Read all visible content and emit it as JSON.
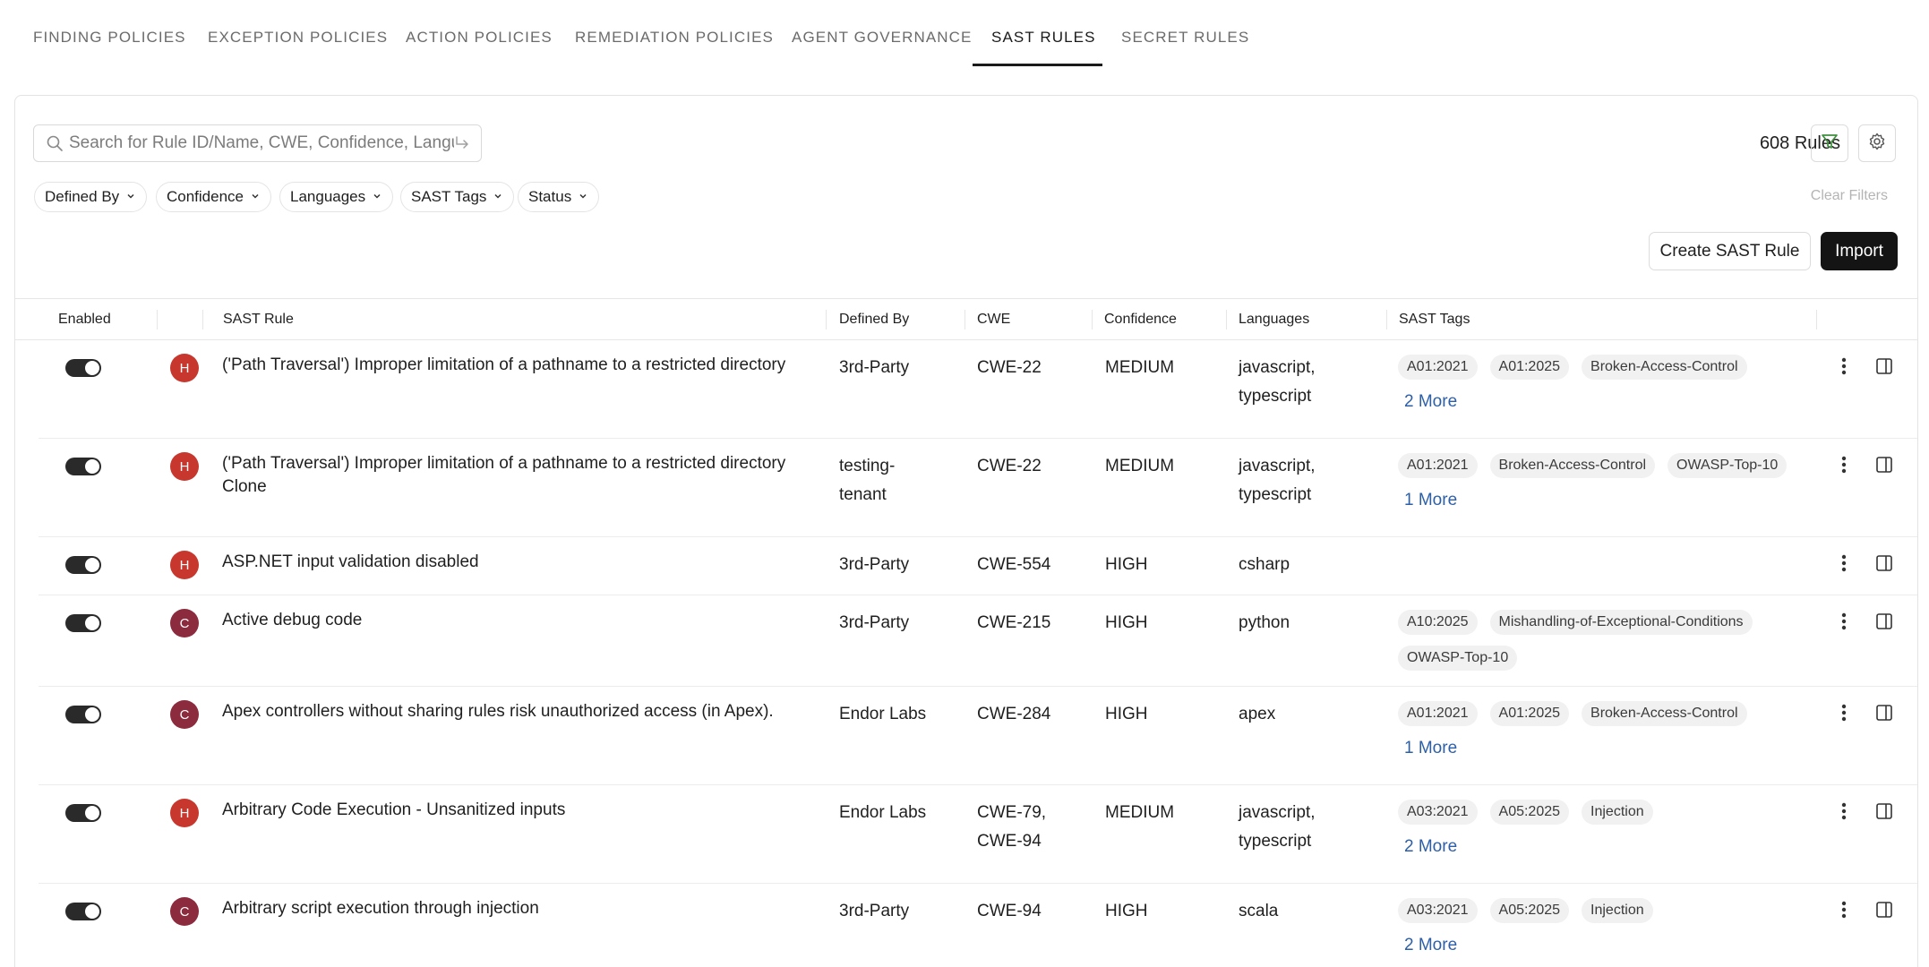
{
  "tabs": [
    {
      "label": "FINDING POLICIES"
    },
    {
      "label": "EXCEPTION POLICIES"
    },
    {
      "label": "ACTION POLICIES"
    },
    {
      "label": "REMEDIATION POLICIES"
    },
    {
      "label": "AGENT GOVERNANCE"
    },
    {
      "label": "SAST RULES",
      "active": true
    },
    {
      "label": "SECRET RULES"
    }
  ],
  "search": {
    "placeholder": "Search for Rule ID/Name, CWE, Confidence, Language",
    "value": ""
  },
  "rules_count": "608 Rules",
  "filters": [
    "Defined By",
    "Confidence",
    "Languages",
    "SAST Tags",
    "Status"
  ],
  "clear_filters": "Clear Filters",
  "actions": {
    "create": "Create SAST Rule",
    "import": "Import"
  },
  "columns": {
    "enabled": "Enabled",
    "rule": "SAST Rule",
    "defined_by": "Defined By",
    "cwe": "CWE",
    "confidence": "Confidence",
    "languages": "Languages",
    "tags": "SAST Tags"
  },
  "rows": [
    {
      "enabled": true,
      "severity": "H",
      "name": "('Path Traversal') Improper limitation of a pathname to a restricted directory",
      "defined_by": "3rd-Party",
      "cwe": "CWE-22",
      "confidence": "MEDIUM",
      "languages": "javascript,\ntypescript",
      "tags": [
        "A01:2021",
        "A01:2025",
        "Broken-Access-Control"
      ],
      "more": "2 More"
    },
    {
      "enabled": true,
      "severity": "H",
      "name": "('Path Traversal') Improper limitation of a pathname to a restricted directory Clone",
      "defined_by": "testing-\ntenant",
      "cwe": "CWE-22",
      "confidence": "MEDIUM",
      "languages": "javascript,\ntypescript",
      "tags": [
        "A01:2021",
        "Broken-Access-Control",
        "OWASP-Top-10"
      ],
      "more": "1 More"
    },
    {
      "enabled": true,
      "severity": "H",
      "name": "ASP.NET input validation disabled",
      "defined_by": "3rd-Party",
      "cwe": "CWE-554",
      "confidence": "HIGH",
      "languages": "csharp",
      "tags": [],
      "more": ""
    },
    {
      "enabled": true,
      "severity": "C",
      "name": "Active debug code",
      "defined_by": "3rd-Party",
      "cwe": "CWE-215",
      "confidence": "HIGH",
      "languages": "python",
      "tags": [
        "A10:2025",
        "Mishandling-of-Exceptional-Conditions",
        "OWASP-Top-10"
      ],
      "more": ""
    },
    {
      "enabled": true,
      "severity": "C",
      "name": "Apex controllers without sharing rules risk unauthorized access (in Apex).",
      "defined_by": "Endor Labs",
      "cwe": "CWE-284",
      "confidence": "HIGH",
      "languages": "apex",
      "tags": [
        "A01:2021",
        "A01:2025",
        "Broken-Access-Control"
      ],
      "more": "1 More"
    },
    {
      "enabled": true,
      "severity": "H",
      "name": "Arbitrary Code Execution - Unsanitized inputs",
      "defined_by": "Endor Labs",
      "cwe": "CWE-79,\nCWE-94",
      "confidence": "MEDIUM",
      "languages": "javascript,\ntypescript",
      "tags": [
        "A03:2021",
        "A05:2025",
        "Injection"
      ],
      "more": "2 More"
    },
    {
      "enabled": true,
      "severity": "C",
      "name": "Arbitrary script execution through injection",
      "defined_by": "3rd-Party",
      "cwe": "CWE-94",
      "confidence": "HIGH",
      "languages": "scala",
      "tags": [
        "A03:2021",
        "A05:2025",
        "Injection"
      ],
      "more": "2 More"
    }
  ],
  "colors": {
    "accent": "#1a1a1a",
    "severity_high": "#c8372d",
    "severity_critical": "#8b2b3d",
    "link": "#2d5fa8",
    "filter_icon": "#3f8f3f"
  }
}
